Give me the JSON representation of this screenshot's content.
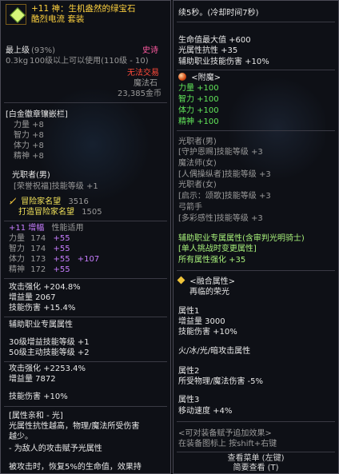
{
  "left": {
    "title_line1": "+11 神：生机盎然的绿宝石",
    "title_line2": "酷烈电流 套装",
    "grade": "最上级",
    "grade_pct": "(93%)",
    "rarity": "史诗",
    "weight": "0.3kg",
    "level_req": "100级以上可以使用(110级 - 10)",
    "trade": "无法交易",
    "item_type": "魔法石",
    "price": "23,385金币",
    "badge_slot": "[白金徽章镶嵌栏]",
    "badge_stats": [
      "力量 +8",
      "智力 +8",
      "体力 +8",
      "精神 +8"
    ],
    "job_header": "光职者(男)",
    "job_skill": "[荣誉祝福]技能等级 +1",
    "adventurer_fame_label": "冒险家名望",
    "adventurer_fame_value": "3516",
    "forge_fame_label": "打造冒险家名望",
    "forge_fame_value": "1505",
    "amplify_header": "+11 增幅",
    "amplify_desc": "性能适用",
    "amp_stats": [
      {
        "name": "力量",
        "base": "174",
        "bonus": "+55",
        "extra": ""
      },
      {
        "name": "智力",
        "base": "174",
        "bonus": "+55",
        "extra": ""
      },
      {
        "name": "体力",
        "base": "173",
        "bonus": "+55",
        "extra": "+107"
      },
      {
        "name": "精神",
        "base": "172",
        "bonus": "+55",
        "extra": ""
      }
    ],
    "attack_boost": "攻击强化 +204.8%",
    "gain_amount": "增益量 2067",
    "skill_damage": "技能伤害 +15.4%",
    "aux_header": "辅助职业专属属性",
    "aux_lines": [
      "30级增益技能等级 +1",
      "50级主动技能等级 +2"
    ],
    "attack_boost2": "攻击强化 +2253.4%",
    "gain_amount2": "增益量 7872",
    "skill_damage2": "技能伤害 +10%",
    "affinity_header": "[属性亲和 - 光]",
    "affinity_line1": "光属性抗性越高，物理/魔法所受伤害",
    "affinity_line2": "越少。",
    "affinity_line3": "- 为敌人的攻击赋予光属性",
    "affinity_line4": "被攻击时，恢复5%的生命值，效果持"
  },
  "right": {
    "duration": "续5秒。(冷却时间7秒)",
    "hp_max": "生命值最大值 +600",
    "light_res": "光属性抗性 +35",
    "aux_skill_dmg": "辅助职业技能伤害 +10%",
    "enchant_header": "<附魔>",
    "enchant_stats": [
      "力量 +100",
      "智力 +100",
      "体力 +100",
      "精神 +100"
    ],
    "light_job": "光职者(男)",
    "job_lines": [
      "[守护恩赐]技能等级 +3",
      "魔法师(女)",
      "[人偶操纵者]技能等级 +3",
      "光职者(女)",
      "[启示：颂歌]技能等级 +3",
      "弓箭手",
      "[多彩感性]技能等级 +3"
    ],
    "aux_exclusive": "辅助职业专属属性(含审判光明骑士)",
    "single_buff": "[单人挑战时变更属性]",
    "all_stat": "所有属性强化 +35",
    "fusion_header": "<融合属性>",
    "fusion_name": "再临的荣光",
    "attr1_label": "属性1",
    "attr1_lines": [
      "增益量 3000",
      "技能伤害 +10%"
    ],
    "element_line": "火/冰/光/暗攻击属性",
    "attr2_label": "属性2",
    "attr2_line": "所受物理/魔法伤害 -5%",
    "attr3_label": "属性3",
    "attr3_line": "移动速度 +4%",
    "equip_effect_header": "<可对装备赋予追加效果>",
    "equip_effect_hint": "在装备图标上 按shift+右键",
    "view_menu": "查看菜单 (左键)",
    "brief_view": "简要查看 (T)"
  }
}
